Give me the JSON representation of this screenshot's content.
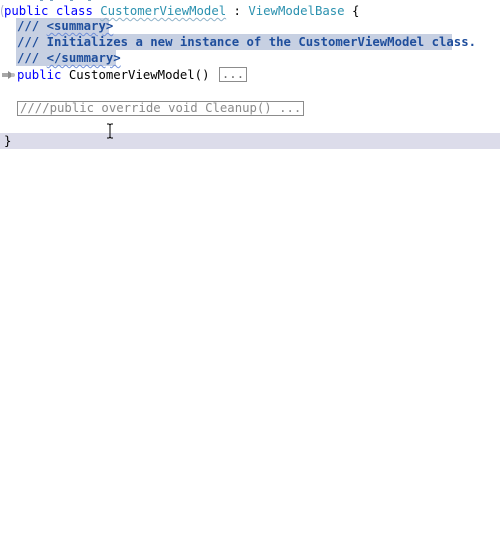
{
  "code": {
    "class_decl": {
      "kw_public": "public",
      "kw_class": "class",
      "class_name": "CustomerViewModel",
      "colon": " : ",
      "base_type": "ViewModelBase",
      "brace_open": " {"
    },
    "summary_open": {
      "slashes": "/// ",
      "tag": "<summary>"
    },
    "summary_text": "/// Initializes a new instance of the CustomerViewModel class.",
    "summary_close": {
      "slashes": "/// ",
      "tag": "</summary>"
    },
    "ctor_line": {
      "kw_public": "public",
      "name": " CustomerViewModel() ",
      "collapsed": "..."
    },
    "cleanup_line": "////public override void Cleanup() ...",
    "brace_close": "}"
  },
  "colors": {
    "keyword": "#0000ff",
    "type": "#2b91af",
    "doc_comment": "#1f4e9c",
    "selection": "#c7d0e2",
    "current_line": "#dcdcea"
  },
  "icons": {
    "margin_glyph": "breakpoint-arrow-icon",
    "cursor": "text-cursor-icon"
  }
}
